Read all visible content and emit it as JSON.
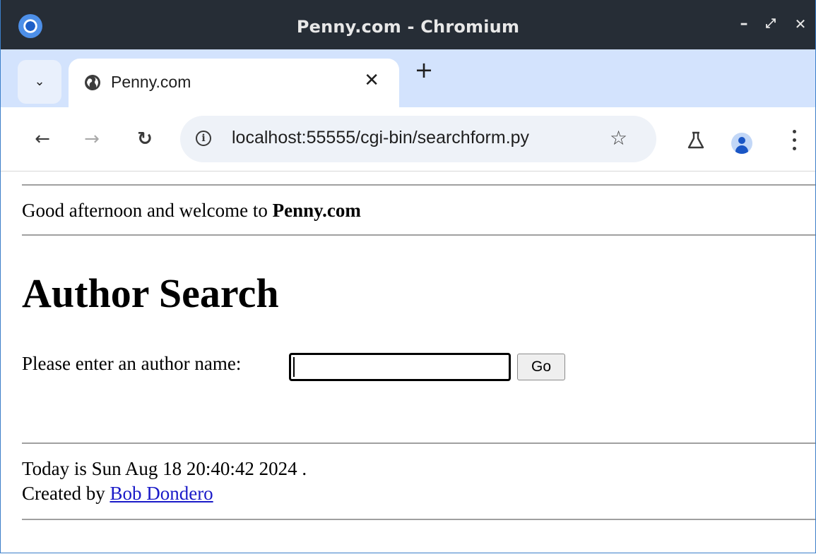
{
  "window": {
    "title": "Penny.com - Chromium",
    "controls": {
      "minimize": "–",
      "maximize": "⤢",
      "close": "✕"
    }
  },
  "tabs": [
    {
      "title": "Penny.com",
      "active": true,
      "close_glyph": "✕"
    }
  ],
  "tabstrip": {
    "dropdown_glyph": "⌄",
    "new_tab_glyph": "+"
  },
  "toolbar": {
    "back_glyph": "←",
    "forward_glyph": "→",
    "reload_glyph": "↻",
    "url": "localhost:55555/cgi-bin/searchform.py",
    "site_info_glyph": "i",
    "bookmark_glyph": "☆",
    "icons": [
      "info-icon",
      "star-icon",
      "labs-icon",
      "profile-icon",
      "menu-icon"
    ]
  },
  "page": {
    "greeting_prefix": "Good afternoon and welcome to ",
    "greeting_site": "Penny.com",
    "heading": "Author Search",
    "prompt": "Please enter an author name: ",
    "author_input_value": "",
    "go_label": "Go",
    "today_text": "Today is Sun Aug 18 20:40:42 2024 .",
    "created_prefix": "Created by ",
    "created_link": "Bob Dondero"
  },
  "colors": {
    "titlebar": "#262d36",
    "tabstrip": "#d3e3fd",
    "omnibox": "#eef2f8",
    "link": "#1a1ac8",
    "profile_accent": "#1a56c5"
  }
}
